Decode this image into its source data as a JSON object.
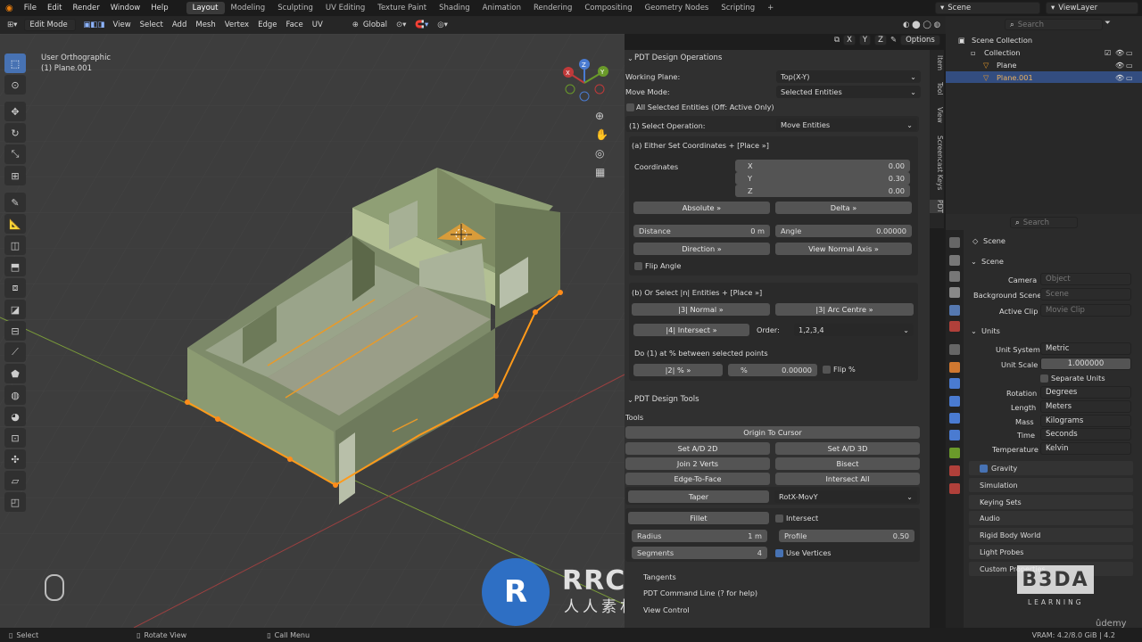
{
  "menus": [
    "File",
    "Edit",
    "Render",
    "Window",
    "Help"
  ],
  "workspaces": [
    "Layout",
    "Modeling",
    "Sculpting",
    "UV Editing",
    "Texture Paint",
    "Shading",
    "Animation",
    "Rendering",
    "Compositing",
    "Geometry Nodes",
    "Scripting"
  ],
  "scene": "Scene",
  "view_layer": "ViewLayer",
  "header": {
    "mode": "Edit Mode",
    "menus": [
      "View",
      "Select",
      "Add",
      "Mesh",
      "Vertex",
      "Edge",
      "Face",
      "UV"
    ],
    "transform": "Global",
    "options": "Options",
    "axes": [
      "X",
      "Y",
      "Z"
    ]
  },
  "viewport": {
    "view_name": "User Orthographic",
    "object_name": "(1) Plane.001",
    "gizmo": {
      "x": "X",
      "y": "Y",
      "z": "Z"
    }
  },
  "pdt": {
    "ops_title": "PDT Design Operations",
    "working_plane_label": "Working Plane:",
    "working_plane": "Top(X-Y)",
    "move_mode_label": "Move Mode:",
    "move_mode": "Selected Entities",
    "all_selected": "All Selected Entities (Off: Active Only)",
    "select_op_label": "(1) Select Operation:",
    "select_op": "Move Entities",
    "a_title": "(a) Either Set Coordinates + [Place »]",
    "coords_label": "Coordinates",
    "x_label": "X",
    "x": "0.00",
    "y_label": "Y",
    "y": "0.30",
    "z_label": "Z",
    "z": "0.00",
    "absolute": "Absolute »",
    "delta": "Delta »",
    "distance_label": "Distance",
    "distance": "0 m",
    "angle_label": "Angle",
    "angle": "0.00000",
    "direction": "Direction »",
    "view_normal": "View Normal Axis »",
    "flip_angle": "Flip Angle",
    "b_title": "(b) Or Select |n| Entities + [Place »]",
    "normal3": "|3| Normal »",
    "arc3": "|3| Arc Centre »",
    "intersect4": "|4| Intersect »",
    "order_label": "Order:",
    "order": "1,2,3,4",
    "do_pct": "Do (1) at % between selected points",
    "pct2": "|2| % »",
    "pct_label": "%",
    "pct": "0.00000",
    "flip_pct": "Flip %",
    "tools_title": "PDT Design Tools",
    "tools_label": "Tools",
    "origin_cursor": "Origin To Cursor",
    "set_ad2": "Set A/D 2D",
    "set_ad3": "Set A/D 3D",
    "join2": "Join 2 Verts",
    "bisect": "Bisect",
    "edge_face": "Edge-To-Face",
    "intersect_all": "Intersect All",
    "taper": "Taper",
    "taper_mode": "RotX-MovY",
    "fillet": "Fillet",
    "fillet_intersect": "Intersect",
    "radius_label": "Radius",
    "radius": "1 m",
    "profile_label": "Profile",
    "profile": "0.50",
    "segments_label": "Segments",
    "segments": "4",
    "use_vertices": "Use Vertices",
    "tangents": "Tangents",
    "command_line": "PDT Command Line (? for help)",
    "view_control": "View Control"
  },
  "side_tabs": [
    "Item",
    "Tool",
    "View",
    "Screencast Keys",
    "PDT"
  ],
  "outliner": {
    "search": "Search",
    "root": "Scene Collection",
    "collection": "Collection",
    "items": [
      "Plane",
      "Plane.001"
    ]
  },
  "props": {
    "search": "Search",
    "scene": "Scene",
    "scene_panel": "Scene",
    "camera_label": "Camera",
    "camera": "Object",
    "bg_label": "Background Scene",
    "bg": "Scene",
    "clip_label": "Active Clip",
    "clip": "Movie Clip",
    "units_panel": "Units",
    "unit_system_label": "Unit System",
    "unit_system": "Metric",
    "unit_scale_label": "Unit Scale",
    "unit_scale": "1.000000",
    "separate_units": "Separate Units",
    "rotation_label": "Rotation",
    "rotation": "Degrees",
    "length_label": "Length",
    "length": "Meters",
    "mass_label": "Mass",
    "mass": "Kilograms",
    "time_label": "Time",
    "time": "Seconds",
    "temp_label": "Temperature",
    "temp": "Kelvin",
    "panels": [
      "Gravity",
      "Simulation",
      "Keying Sets",
      "Audio",
      "Rigid Body World",
      "Light Probes",
      "Custom Properties"
    ]
  },
  "watermark": {
    "rrcg": "RRCG",
    "sub": "人人素材",
    "b3da": "B3DA",
    "learning": "LEARNING",
    "udemy": "ûdemy"
  },
  "status": {
    "select": "Select",
    "rotate": "Rotate View",
    "call_menu": "Call Menu",
    "version": "VRAM: 4.2/8.0 GiB | 4.2"
  }
}
